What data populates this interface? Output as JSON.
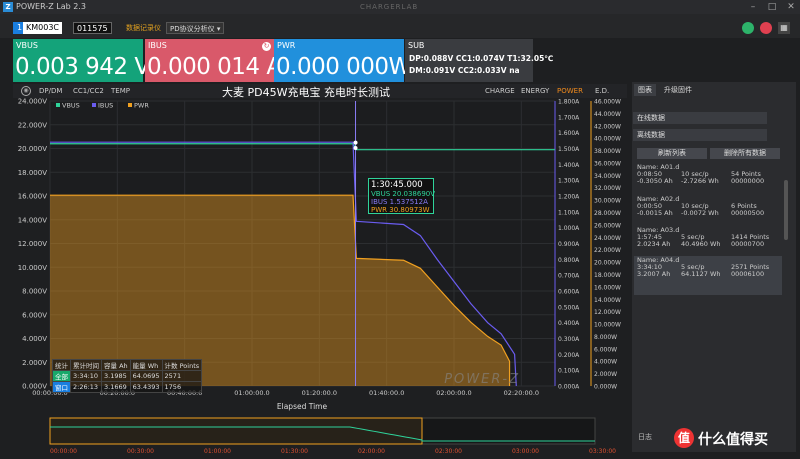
{
  "app": {
    "title": "POWER-Z Lab 2.3",
    "center_logo": "CHARGERLAB",
    "logo_glyph": "Z"
  },
  "device": {
    "index": "1",
    "model": "KM003C",
    "serial": "011575"
  },
  "header_tabs": {
    "record": "数据记录仪",
    "pd": "PD协议分析仪"
  },
  "meters": {
    "vbus": {
      "label": "VBUS",
      "value": "0.003 942 V",
      "color": "#14a37a"
    },
    "ibus": {
      "label": "IBUS",
      "value": "0.000 014 A",
      "color": "#d9596a"
    },
    "pwr": {
      "label": "PWR",
      "value": "0.000 000W",
      "color": "#2190dc"
    },
    "sub": {
      "label": "SUB",
      "line1": "DP:0.088V  CC1:0.074V  T1:32.05℃",
      "line2": "DM:0.091V  CC2:0.033V  na"
    }
  },
  "toolbar": {
    "left": [
      "DP/DM",
      "CC1/CC2",
      "TEMP"
    ],
    "right": [
      "CHARGE",
      "ENERGY",
      "POWER",
      "E.D."
    ],
    "active_right": "POWER",
    "title": "大麦 PD45W充电宝 充电时长测试"
  },
  "chart_data": {
    "type": "line",
    "legend": [
      "VBUS",
      "IBUS",
      "PWR"
    ],
    "legend_colors": [
      "#2fd39a",
      "#6a5cf0",
      "#f0a020"
    ],
    "xlabel": "Elapsed Time",
    "x_ticks": [
      "00:00:00.0",
      "00:20:00.0",
      "00:40:00.0",
      "01:00:00.0",
      "01:20:00.0",
      "01:40:00.0",
      "02:00:00.0",
      "02:20:00.0"
    ],
    "y_left_ticks": [
      "0.000V",
      "2.000V",
      "4.000V",
      "6.000V",
      "8.000V",
      "10.000V",
      "12.000V",
      "14.000V",
      "16.000V",
      "18.000V",
      "20.000V",
      "22.000V",
      "24.000V"
    ],
    "y_mid_ticks": [
      "0.000A",
      "0.100A",
      "0.200A",
      "0.300A",
      "0.400A",
      "0.500A",
      "0.600A",
      "0.700A",
      "0.800A",
      "0.900A",
      "1.000A",
      "1.100A",
      "1.200A",
      "1.300A",
      "1.400A",
      "1.500A",
      "1.600A",
      "1.700A",
      "1.800A"
    ],
    "y_right_ticks": [
      "0.000W",
      "2.000W",
      "4.000W",
      "6.000W",
      "8.000W",
      "10.000W",
      "12.000W",
      "14.000W",
      "16.000W",
      "18.000W",
      "20.000W",
      "22.000W",
      "24.000W",
      "26.000W",
      "28.000W",
      "30.000W",
      "32.000W",
      "34.000W",
      "36.000W",
      "38.000W",
      "40.000W",
      "42.000W",
      "44.000W",
      "46.000W"
    ],
    "x_minutes_range": [
      0,
      150
    ],
    "series": [
      {
        "name": "VBUS",
        "unit": "V",
        "points": [
          [
            0,
            20.4
          ],
          [
            90,
            20.4
          ],
          [
            91,
            19.9
          ],
          [
            160,
            19.9
          ]
        ]
      },
      {
        "name": "IBUS",
        "unit": "A",
        "points": [
          [
            0,
            1.54
          ],
          [
            90,
            1.54
          ],
          [
            91,
            1.04
          ],
          [
            105,
            1.02
          ],
          [
            110,
            0.95
          ],
          [
            115,
            0.8
          ],
          [
            120,
            0.66
          ],
          [
            125,
            0.52
          ],
          [
            130,
            0.4
          ],
          [
            134,
            0.33
          ],
          [
            138,
            0.2
          ],
          [
            138.5,
            0.0
          ]
        ]
      },
      {
        "name": "PWR",
        "unit": "W",
        "points": [
          [
            0,
            30.8
          ],
          [
            90,
            30.8
          ],
          [
            91,
            20.6
          ],
          [
            105,
            20.3
          ],
          [
            110,
            19.0
          ],
          [
            115,
            16.0
          ],
          [
            120,
            13.0
          ],
          [
            125,
            10.3
          ],
          [
            130,
            8.0
          ],
          [
            134,
            6.6
          ],
          [
            136.5,
            4.0
          ],
          [
            136.5,
            0.0
          ]
        ]
      }
    ],
    "cursor": {
      "time": "1:30:45.000",
      "vbus": "20.038690V",
      "ibus": "1.537512A",
      "pwr": "30.80973W"
    },
    "stats": {
      "headers": [
        "统计",
        "累计时间",
        "容量 Ah",
        "能量 Wh",
        "计数 Points"
      ],
      "rows": [
        [
          "全部",
          "3:34:10",
          "3.1985",
          "64.0695",
          "2571"
        ],
        [
          "窗口",
          "2:26:13",
          "3.1669",
          "63.4393",
          "1756"
        ]
      ]
    },
    "watermark": "POWER-Z"
  },
  "side": {
    "tabs": [
      "图表",
      "升级固件"
    ],
    "online": "在线数据",
    "offline": "离线数据",
    "refresh": "刷新列表",
    "delete_all": "删除所有数据",
    "records": [
      {
        "name": "Name: A01.d",
        "t": "0:08:50",
        "rate": "10 sec/p",
        "points": "54 Points",
        "ah": "-0.3050 Ah",
        "wh": "-2.7266 Wh",
        "id": "00000000"
      },
      {
        "name": "Name: A02.d",
        "t": "0:00:50",
        "rate": "10 sec/p",
        "points": "6 Points",
        "ah": "-0.0015 Ah",
        "wh": "-0.0072 Wh",
        "id": "00000500"
      },
      {
        "name": "Name: A03.d",
        "t": "1:57:45",
        "rate": "5 sec/p",
        "points": "1414 Points",
        "ah": "2.0234 Ah",
        "wh": "40.4960 Wh",
        "id": "00000700"
      },
      {
        "name": "Name: A04.d",
        "t": "3:34:10",
        "rate": "5 sec/p",
        "points": "2571 Points",
        "ah": "3.2007 Ah",
        "wh": "64.1127 Wh",
        "id": "00006100"
      }
    ],
    "log": "日志"
  },
  "timeline": {
    "ticks": [
      "00:00:00",
      "00:30:00",
      "01:00:00",
      "01:30:00",
      "02:00:00",
      "02:30:00",
      "03:00:00",
      "03:30:00"
    ]
  },
  "watermark_site": {
    "glyph": "值",
    "text": "什么值得买"
  }
}
